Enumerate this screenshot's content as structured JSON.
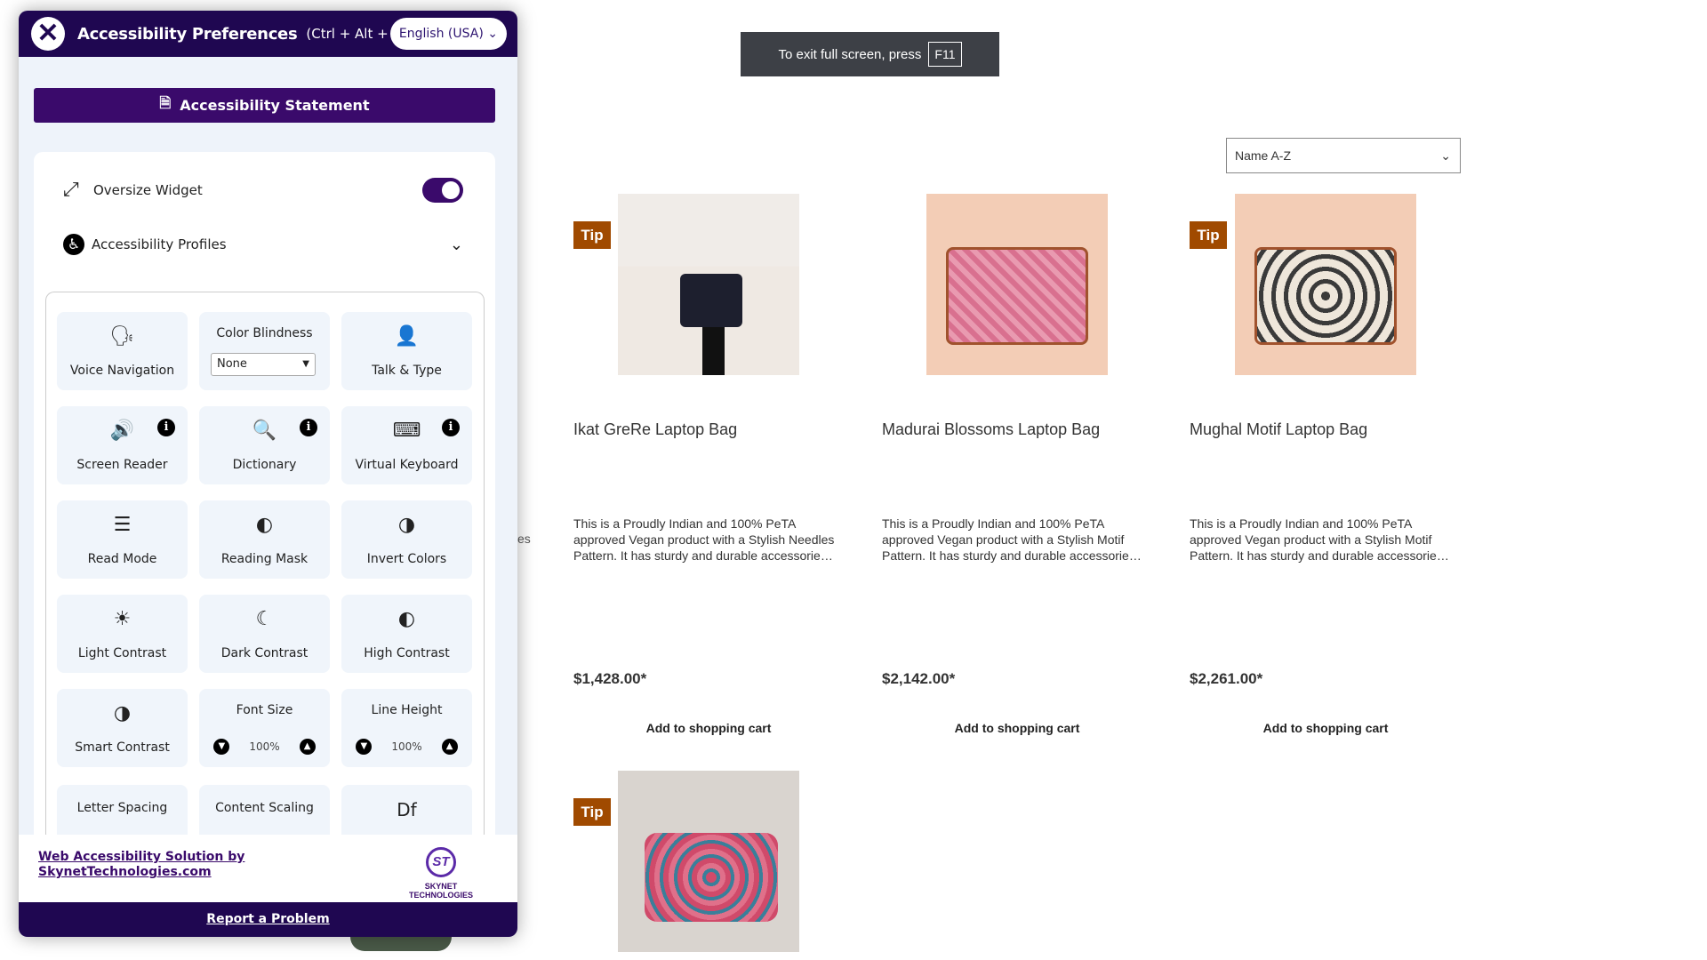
{
  "widget": {
    "title": "Accessibility Preferences",
    "shortcut": "(Ctrl + Alt + A)",
    "language": "English (USA)",
    "statement_label": "Accessibility Statement",
    "oversize_label": "Oversize Widget",
    "oversize_on": true,
    "profiles_label": "Accessibility Profiles",
    "tiles": {
      "voice_navigation": "Voice Navigation",
      "color_blindness": "Color Blindness",
      "color_blindness_value": "None",
      "talk_type": "Talk & Type",
      "screen_reader": "Screen Reader",
      "dictionary": "Dictionary",
      "virtual_keyboard": "Virtual Keyboard",
      "read_mode": "Read Mode",
      "reading_mask": "Reading Mask",
      "invert_colors": "Invert Colors",
      "light_contrast": "Light Contrast",
      "dark_contrast": "Dark Contrast",
      "high_contrast": "High Contrast",
      "smart_contrast": "Smart Contrast",
      "font_size": "Font Size",
      "font_size_value": "100%",
      "line_height": "Line Height",
      "line_height_value": "100%",
      "letter_spacing": "Letter Spacing",
      "content_scaling": "Content Scaling",
      "dyslexia_font": "Df"
    },
    "footer_link": "Web Accessibility Solution by SkynetTechnologies.com",
    "logo_text": "SKYNET TECHNOLOGIES",
    "logo_mark": "ST",
    "report_label": "Report a Problem"
  },
  "toast": {
    "text": "To exit full screen, press",
    "key": "F11"
  },
  "sort": {
    "value": "Name A-Z"
  },
  "partial_text": "es",
  "products": [
    {
      "tip": "Tip",
      "title": "Ikat GreRe Laptop Bag",
      "desc": "This is a Proudly Indian and 100% PeTA approved Vegan product with a Stylish Needles Pattern. It has sturdy and durable accessorie…",
      "price": "$1,428.00*",
      "cart": "Add to shopping cart"
    },
    {
      "title": "Madurai Blossoms Laptop Bag",
      "desc": "This is a Proudly Indian and 100% PeTA approved Vegan product with a Stylish Motif Pattern. It has sturdy and durable accessorie…",
      "price": "$2,142.00*",
      "cart": "Add to shopping cart"
    },
    {
      "tip": "Tip",
      "title": "Mughal Motif Laptop Bag",
      "desc": "This is a Proudly Indian and 100% PeTA approved Vegan product with a Stylish Motif Pattern. It has sturdy and durable accessorie…",
      "price": "$2,261.00*",
      "cart": "Add to shopping cart"
    },
    {
      "tip": "Tip"
    }
  ],
  "colors": {
    "brand": "#1f0751",
    "tip": "#a04a00"
  }
}
